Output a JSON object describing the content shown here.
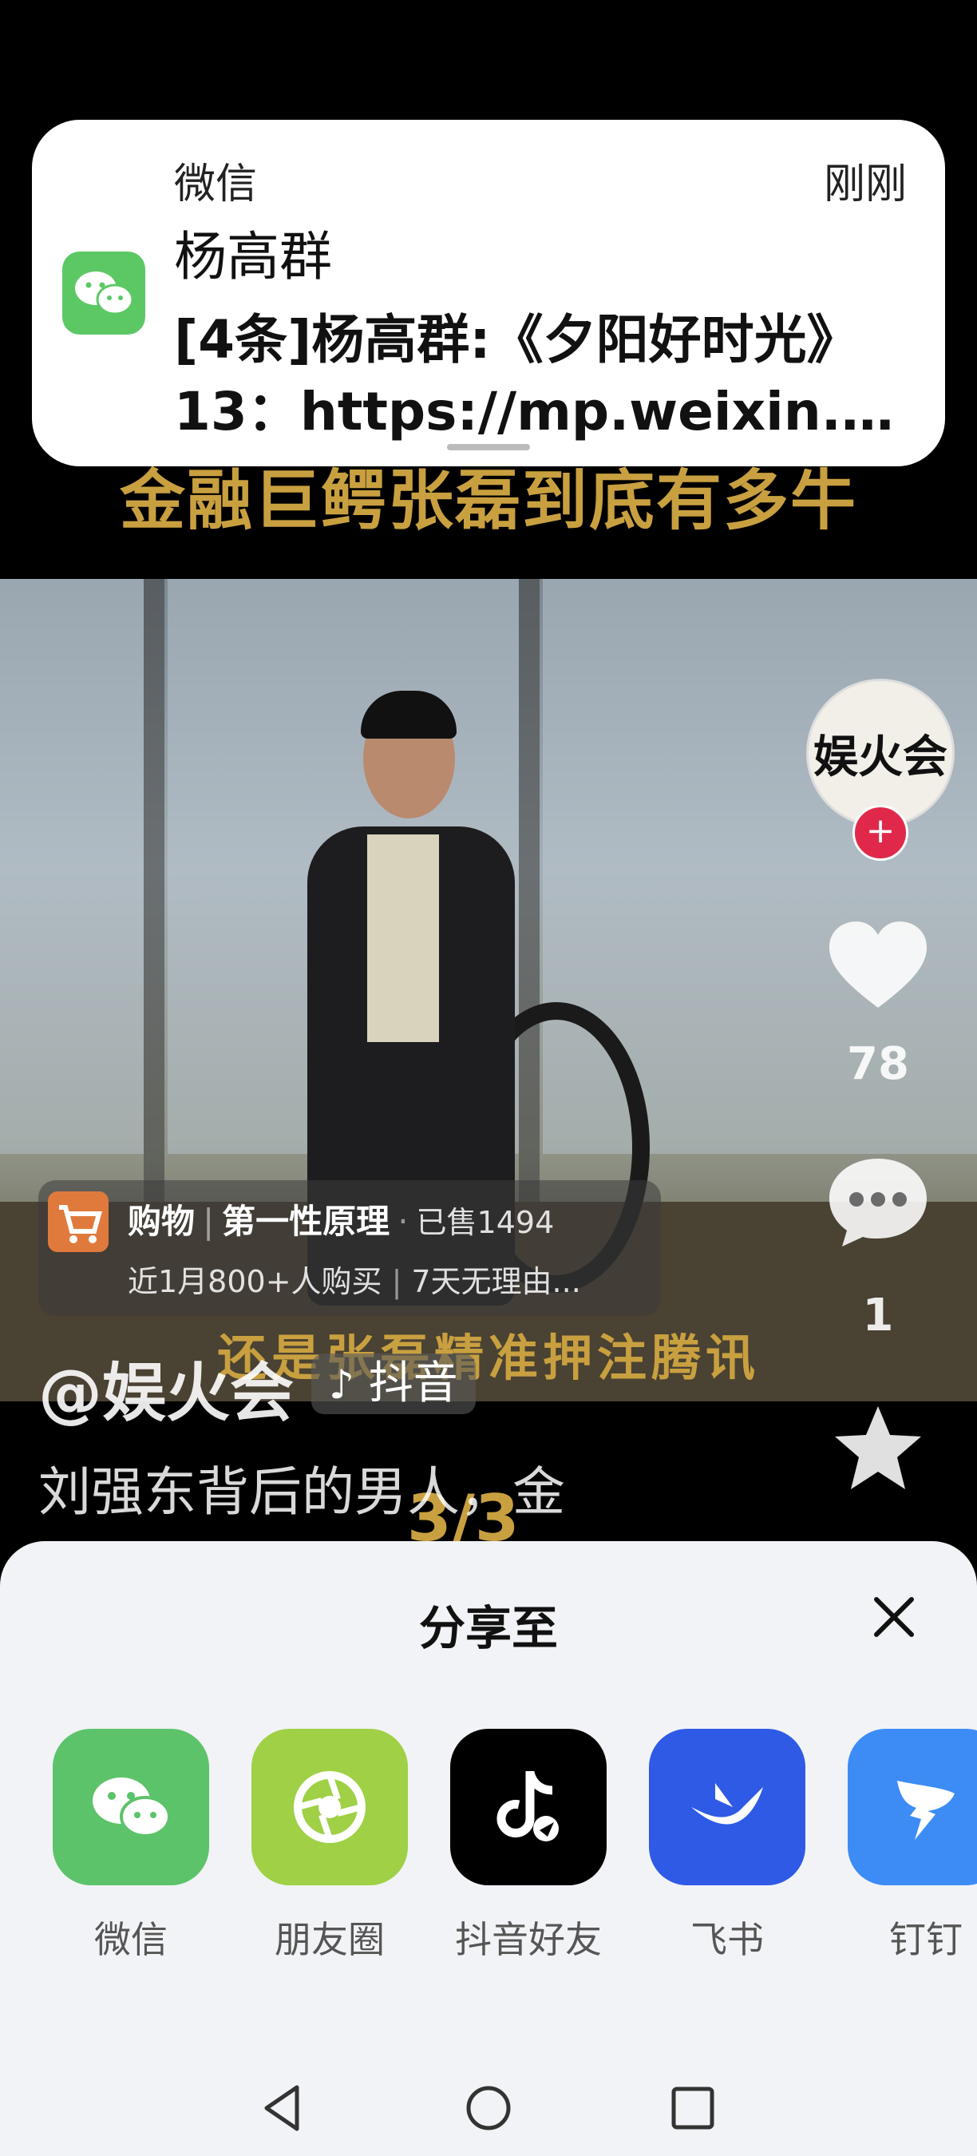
{
  "notification": {
    "app_name": "微信",
    "time": "刚刚",
    "sender": "杨高群",
    "line1": "[4条]杨高群:《夕阳好时光》",
    "line2": "13：https://mp.weixin.qq..."
  },
  "video": {
    "title_banner": "金融巨鳄张磊到底有多牛",
    "subtitle_overlay": "还是张磊精准押注腾讯",
    "page_counter": "3/3",
    "author_avatar_text": "娱火会",
    "like_count": "78",
    "comment_count": "1",
    "shop": {
      "label": "购物",
      "product": "第一性原理",
      "sold": "已售1494",
      "recent": "近1月800+人购买",
      "policy": "7天无理由..."
    },
    "author": "@娱火会",
    "platform_badge": "抖音",
    "caption": "刘强东背后的男人，金"
  },
  "share_sheet": {
    "title": "分享至",
    "targets": [
      {
        "label": "微信",
        "color": "#5cc36a",
        "icon": "wechat-icon"
      },
      {
        "label": "朋友圈",
        "color": "#9fd046",
        "icon": "moments-icon"
      },
      {
        "label": "抖音好友",
        "color": "#000000",
        "icon": "douyin-icon"
      },
      {
        "label": "飞书",
        "color": "#2f5ae6",
        "icon": "feishu-icon"
      },
      {
        "label": "钉钉",
        "color": "#3d8cf5",
        "icon": "dingtalk-icon"
      }
    ]
  },
  "navbar": {
    "buttons": [
      "back",
      "home",
      "recents"
    ]
  }
}
